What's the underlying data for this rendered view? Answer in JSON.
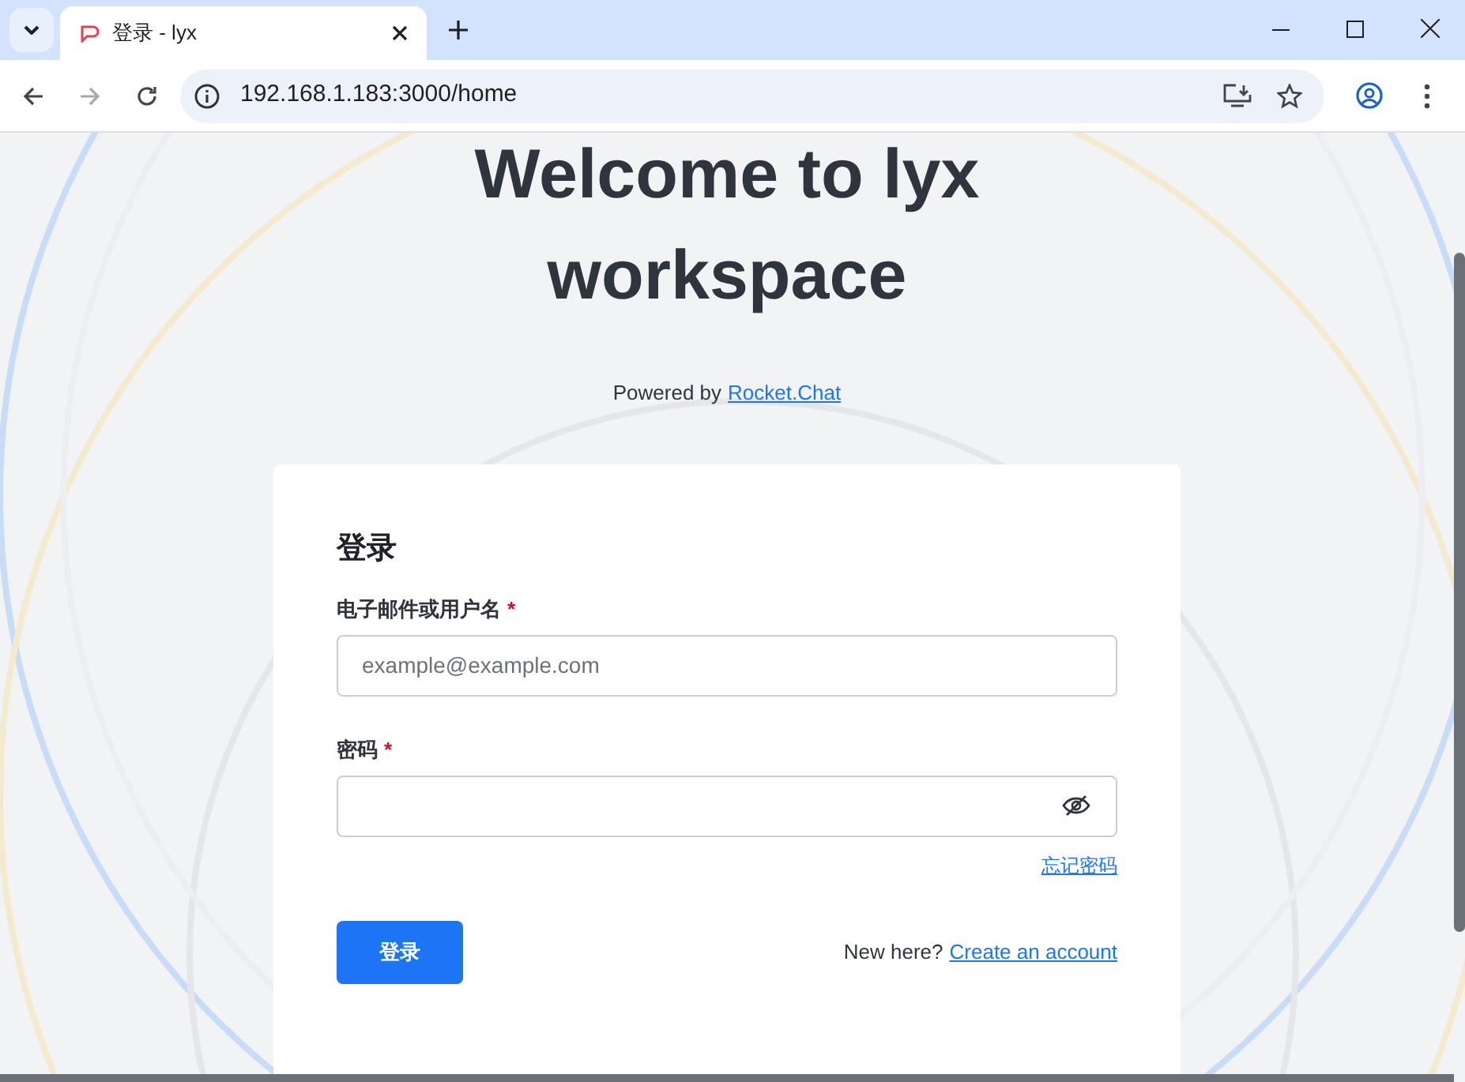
{
  "browser": {
    "tabs": [
      {
        "title": "登录 - lyx",
        "selected": true
      }
    ],
    "url": "192.168.1.183:3000/home"
  },
  "page": {
    "heading": "Welcome to lyx workspace",
    "powered_by": "Powered by",
    "powered_link": "Rocket.Chat"
  },
  "form": {
    "title": "登录",
    "fields": [
      {
        "kind": "text",
        "label": "电子邮件或用户名",
        "required_mark": "*",
        "placeholder": "example@example.com"
      },
      {
        "kind": "password",
        "label": "密码",
        "required_mark": "*"
      }
    ],
    "forgot_link": "忘记密码",
    "submit": "登录",
    "signup_prompt": "New here?",
    "signup_link": "Create an account"
  }
}
